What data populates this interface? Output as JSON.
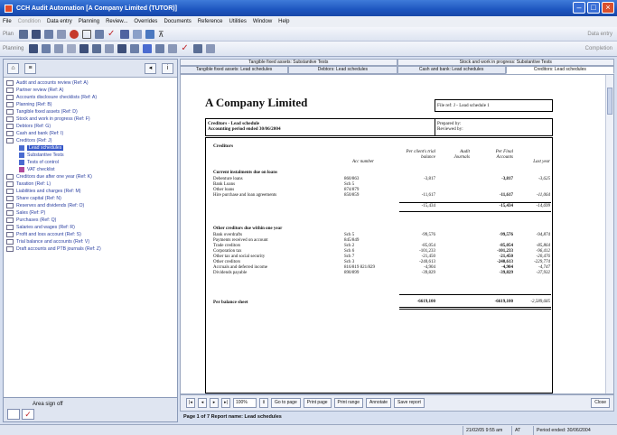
{
  "window": {
    "title": "CCH Audit Automation [A Company Limited (TUTOR)]"
  },
  "menu": [
    "File",
    "Condition",
    "Data entry",
    "Planning",
    "Review...",
    "Overrides",
    "Documents",
    "Reference",
    "Utilities",
    "Window",
    "Help"
  ],
  "toolbar": {
    "row1_label": "Plan",
    "row1_right": "Data entry",
    "row2_label": "Planning",
    "row2_right": "Completion"
  },
  "tree": {
    "items": [
      {
        "label": "Audit and accounts review (Ref: A)"
      },
      {
        "label": "Partner review (Ref: A)"
      },
      {
        "label": "Accounts disclosure checklists (Ref: A)"
      },
      {
        "label": "Planning (Ref: B)"
      },
      {
        "label": "Tangible fixed assets (Ref: D)"
      },
      {
        "label": "Stock and work in progress (Ref: F)"
      },
      {
        "label": "Debtors (Ref: G)"
      },
      {
        "label": "Cash and bank (Ref: I)"
      },
      {
        "label": "Creditors (Ref: J)"
      }
    ],
    "sub": [
      {
        "label": "Lead schedules"
      },
      {
        "label": "Substantive Tests"
      },
      {
        "label": "Tests of control"
      },
      {
        "label": "VAT checklist"
      }
    ],
    "items2": [
      {
        "label": "Creditors due after one year (Ref: K)"
      },
      {
        "label": "Taxation (Ref: L)"
      },
      {
        "label": "Liabilities and charges (Ref: M)"
      },
      {
        "label": "Share capital (Ref: N)"
      },
      {
        "label": "Reserves and dividends (Ref: O)"
      },
      {
        "label": "Sales (Ref: P)"
      },
      {
        "label": "Purchases (Ref: Q)"
      },
      {
        "label": "Salaries and wages (Ref: R)"
      },
      {
        "label": "Profit and loss account (Ref: S)"
      },
      {
        "label": "Trial balance and accounts (Ref: V)"
      },
      {
        "label": "Draft accounts and PTB journals (Ref: Z)"
      }
    ]
  },
  "signoff": {
    "label": "Area sign off"
  },
  "tabs_row1": [
    "Tangible fixed assets: Substantive Tests",
    "Stock and work in progress: Substantive Tests"
  ],
  "tabs_row2": [
    "Tangible fixed assets: Lead schedules",
    "Debtors: Lead schedules",
    "Cash and bank: Lead schedules",
    "Creditors: Lead schedules"
  ],
  "report": {
    "company": "A Company Limited",
    "ref": "File ref: J - Lead schedule 1",
    "subtitle": "Creditors - Lead schedule",
    "period": "Accounting period ended 30/06/2004",
    "prepared": "Prepared by:",
    "reviewed": "Reviewed by:",
    "section": "Creditors",
    "cols": {
      "acc": "Acc number",
      "ptb": "Per client's trial balance",
      "adj": "Audit Journals",
      "final": "Per Final Accounts",
      "last": "Last year"
    },
    "g1_title": "Current instalments due on loans",
    "g1_rows": [
      {
        "label": "Debenture loans",
        "acc": "860/863",
        "ptb": "-3,817",
        "final": "-3,817",
        "last": "-3,625"
      },
      {
        "label": "Bank Loans",
        "acc": "Sch 5",
        "ptb": "",
        "final": "",
        "last": ""
      },
      {
        "label": "Other loans",
        "acc": "874/879",
        "ptb": "",
        "final": "",
        "last": ""
      },
      {
        "label": "Hire purchase and loan agreements",
        "acc": "850/859",
        "ptb": "-11,617",
        "final": "-11,617",
        "last": "-11,064"
      }
    ],
    "g1_total": {
      "ptb": "-15,434",
      "final": "-15,434",
      "last": "-14,699"
    },
    "g2_title": "Other creditors due within one year",
    "g2_rows": [
      {
        "label": "Bank overdrafts",
        "acc": "Sch 5",
        "ptb": "-99,576",
        "final": "-99,576",
        "last": "-94,874"
      },
      {
        "label": "Payments received on account",
        "acc": "845/849",
        "ptb": "",
        "final": "",
        "last": ""
      },
      {
        "label": "Trade creditors",
        "acc": "Sch 2",
        "ptb": "-85,054",
        "final": "-85,054",
        "last": "-85,864"
      },
      {
        "label": "Corporation tax",
        "acc": "Sch 6",
        "ptb": "-101,233",
        "final": "-101,233",
        "last": "-96,412"
      },
      {
        "label": "Other tax and social security",
        "acc": "Sch 7",
        "ptb": "-21,450",
        "final": "-21,450",
        "last": "-20,476"
      },
      {
        "label": "Other creditors",
        "acc": "Sch 3",
        "ptb": "-240,613",
        "final": "-240,613",
        "last": "-229,774"
      },
      {
        "label": "Accruals and deferred income",
        "acc": "816/819 821/829",
        "ptb": "-4,904",
        "final": "-4,904",
        "last": "-4,747"
      },
      {
        "label": "Dividends payable",
        "acc": "890/899",
        "ptb": "-39,829",
        "final": "-39,829",
        "last": "-37,932"
      }
    ],
    "grand_label": "Per balance sheet",
    "grand": {
      "ptb": "-6619,100",
      "final": "-6619,100",
      "last": "-2,589,685"
    }
  },
  "nav": {
    "zoom": "100%",
    "goto": "Go to page",
    "print_page": "Print page",
    "print_range": "Print range",
    "annotate": "Annotate",
    "save": "Save report",
    "close": "Close",
    "page_info": "Page 1 of 7 Report name: Lead schedules"
  },
  "status": {
    "datetime": "21/02/05 9:55 am",
    "user": "AT",
    "period": "Period ended: 30/06/2004"
  },
  "colors": {
    "title_bar": "#2a62c8",
    "selected": "#3355c8",
    "tree_text": "#2a3fa0"
  }
}
